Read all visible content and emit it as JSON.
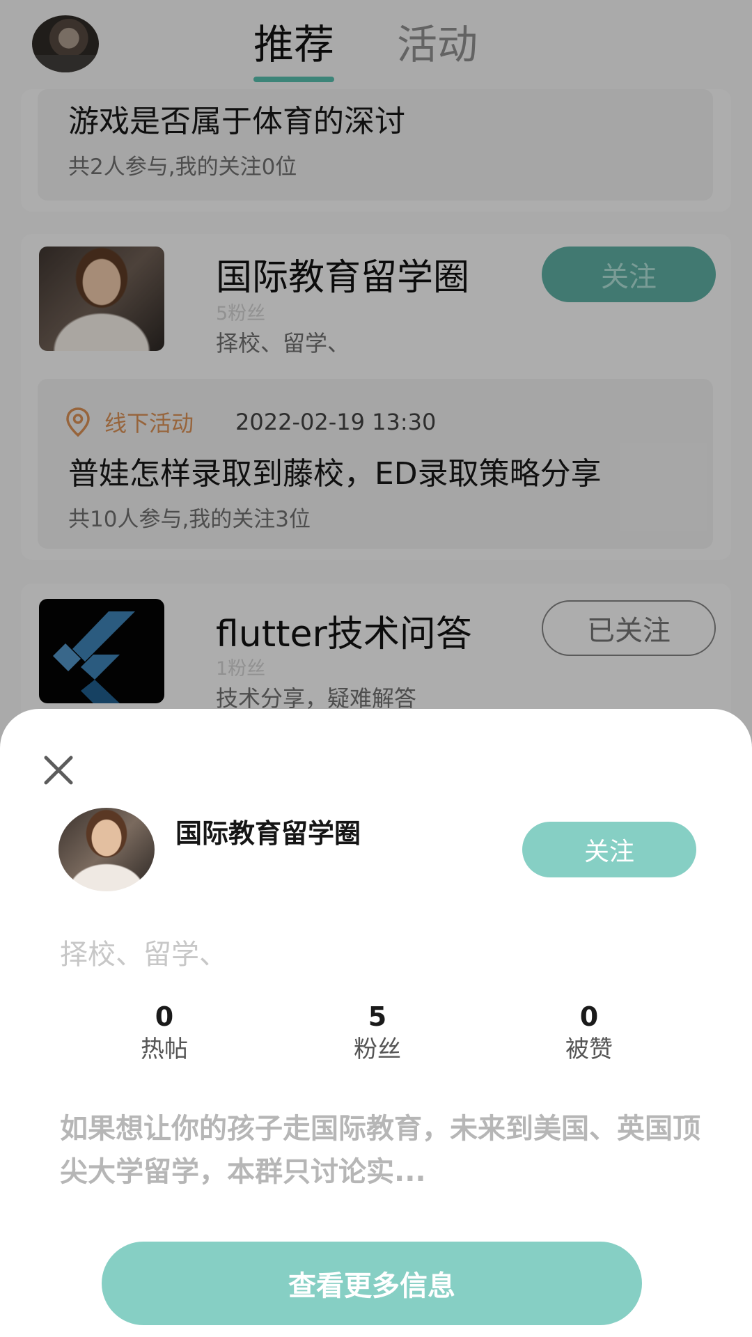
{
  "header": {
    "tabs": [
      {
        "label": "推荐",
        "active": true
      },
      {
        "label": "活动",
        "active": false
      }
    ]
  },
  "feed": {
    "top_activity": {
      "title": "游戏是否属于体育的深讨",
      "participants": "共2人参与,我的关注0位"
    },
    "circles": [
      {
        "name": "国际教育留学圈",
        "fans": "5粉丝",
        "tags": "择校、留学、",
        "follow_label": "关注",
        "followed": false,
        "activity": {
          "type": "线下活动",
          "time": "2022-02-19 13:30",
          "title": "普娃怎样录取到藤校，ED录取策略分享",
          "participants": "共10人参与,我的关注3位"
        }
      },
      {
        "name": "flutter技术问答",
        "fans": "1粉丝",
        "tags": "技术分享，疑难解答",
        "follow_label": "已关注",
        "followed": true
      }
    ]
  },
  "sheet": {
    "name": "国际教育留学圈",
    "follow_label": "关注",
    "tags": "择校、留学、",
    "stats": [
      {
        "value": "0",
        "label": "热帖"
      },
      {
        "value": "5",
        "label": "粉丝"
      },
      {
        "value": "0",
        "label": "被赞"
      }
    ],
    "description": "如果想让你的孩子走国际教育，未来到美国、英国顶尖大学留学，本群只讨论实...",
    "more_button": "查看更多信息"
  },
  "colors": {
    "accent": "#86cfc4",
    "tab_underline": "#54b8a7",
    "activity_type": "#d18b53"
  },
  "icons": [
    "user-avatar",
    "location-pin-icon",
    "close-icon",
    "flutter-logo"
  ]
}
